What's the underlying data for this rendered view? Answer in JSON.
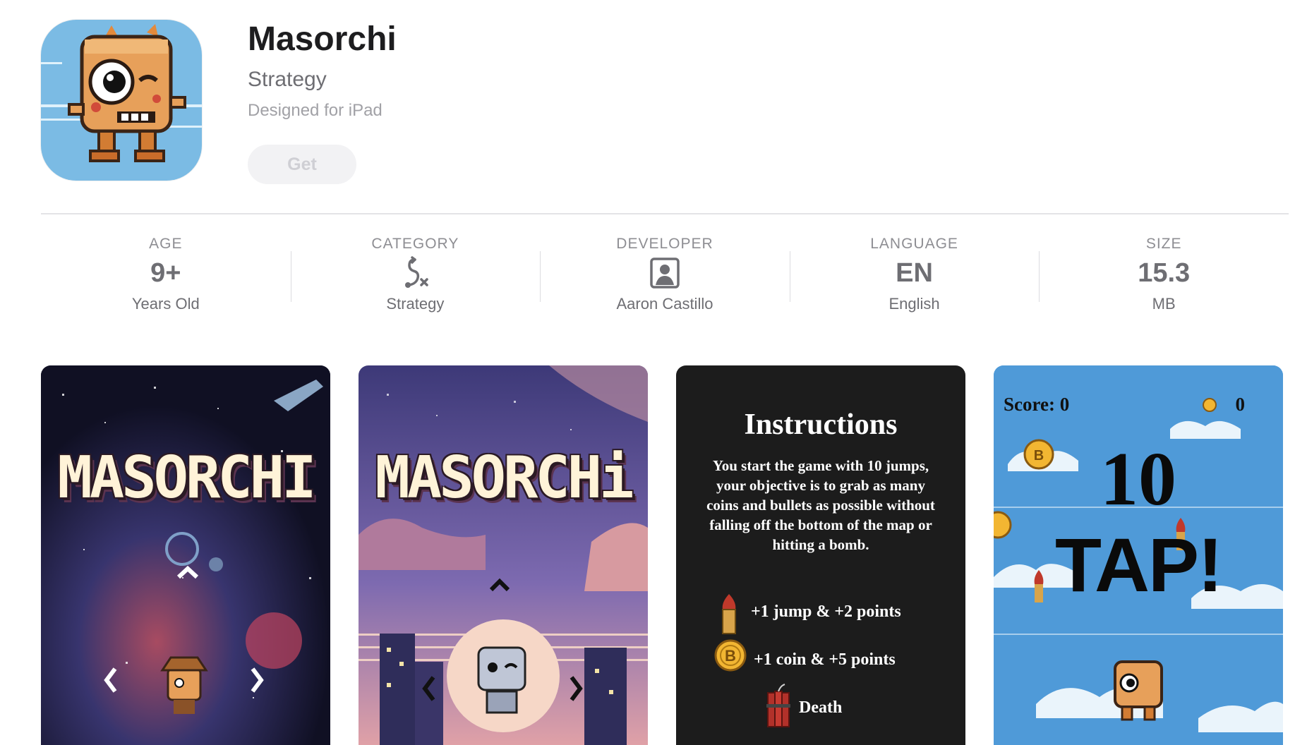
{
  "app": {
    "name": "Masorchi",
    "genre": "Strategy",
    "platform": "Designed for iPad",
    "get_label": "Get"
  },
  "info": [
    {
      "label": "AGE",
      "value": "9+",
      "sub": "Years Old"
    },
    {
      "label": "CATEGORY",
      "icon": "strategy-icon",
      "sub": "Strategy"
    },
    {
      "label": "DEVELOPER",
      "icon": "developer-person-icon",
      "sub": "Aaron Castillo"
    },
    {
      "label": "LANGUAGE",
      "value": "EN",
      "sub": "English"
    },
    {
      "label": "SIZE",
      "value": "15.3",
      "sub": "MB"
    }
  ],
  "screenshots": {
    "shot1": {
      "logo": "MASORCHI"
    },
    "shot2": {
      "logo": "MASORCHi"
    },
    "shot3": {
      "title": "Instructions",
      "body": "You start the game with 10 jumps, your objective is to grab as many coins and bullets as possible without falling off the bottom of the map or hitting a bomb.",
      "rule_bullet": "+1 jump & +2 points",
      "rule_coin": "+1 coin & +5 points",
      "rule_bomb": "Death"
    },
    "shot4": {
      "score": "Score: 0",
      "coins": "0",
      "count": "10",
      "tap": "TAP!"
    }
  },
  "colors": {
    "text_primary": "#1d1d1f",
    "text_secondary": "#6e6e73",
    "button_bg": "#f2f2f4",
    "button_text": "#cfcfd4"
  }
}
